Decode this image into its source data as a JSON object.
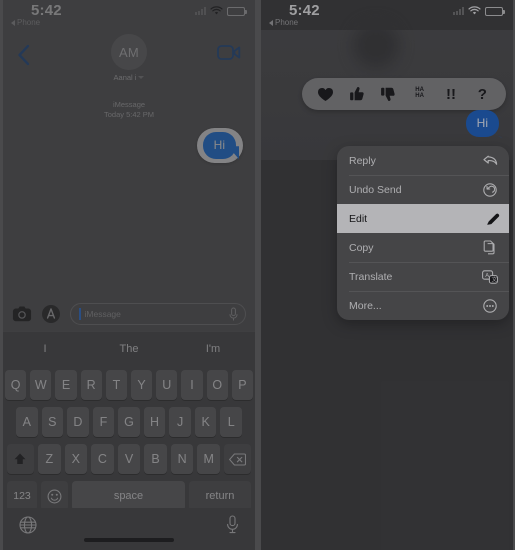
{
  "meta": {
    "app": "Messages",
    "description": "iOS Messages — edit sent message via long-press context menu"
  },
  "colors": {
    "bubble_blue": "#1a7bf2",
    "bubble_blue_dim": "#1b5fc0",
    "menu_bg": "#58585a",
    "selected_row_bg": "#f7f7f9",
    "accent_tint": "#2e7df0"
  },
  "left_panel": {
    "status_bar": {
      "time": "5:42",
      "back_label": "Phone",
      "back_icon": "triangle-left-icon",
      "signal_icon": "cellular-signal-icon",
      "wifi_icon": "wifi-icon",
      "battery_icon": "battery-icon"
    },
    "nav_bar": {
      "back_icon": "chevron-left-icon",
      "facetime_icon": "video-camera-icon",
      "avatar_initials": "AM",
      "contact_name": "Aanal i",
      "disclosure_icon": "chevron-down-icon"
    },
    "thread": {
      "service_label": "iMessage",
      "timestamp": "Today 5:42 PM",
      "messages": [
        {
          "text": "Hi",
          "side": "outgoing",
          "highlighted": true
        }
      ]
    },
    "input_bar": {
      "camera_icon": "camera-icon",
      "apps_icon": "app-store-icon",
      "placeholder": "iMessage",
      "audio_icon": "audio-waveform-icon"
    },
    "predictive_bar": {
      "suggestions": [
        "I",
        "The",
        "I'm"
      ]
    },
    "keyboard": {
      "row1": [
        "Q",
        "W",
        "E",
        "R",
        "T",
        "Y",
        "U",
        "I",
        "O",
        "P"
      ],
      "row2": [
        "A",
        "S",
        "D",
        "F",
        "G",
        "H",
        "J",
        "K",
        "L"
      ],
      "row3": [
        "Z",
        "X",
        "C",
        "V",
        "B",
        "N",
        "M"
      ],
      "shift_icon": "shift-icon",
      "delete_icon": "delete-backward-icon",
      "numbers_label": "123",
      "emoji_icon": "emoji-smiley-icon",
      "space_label": "space",
      "return_label": "return"
    },
    "bottom_bar": {
      "globe_icon": "globe-icon",
      "dictation_icon": "microphone-icon",
      "home_indicator": "home-indicator"
    }
  },
  "right_panel": {
    "status_bar": {
      "time": "5:42",
      "back_label": "Phone",
      "back_icon": "triangle-left-icon",
      "signal_icon": "cellular-signal-icon",
      "wifi_icon": "wifi-icon",
      "battery_icon": "battery-icon"
    },
    "tapbacks": [
      {
        "name": "heart-icon",
        "glyph": "♥",
        "label": "Love"
      },
      {
        "name": "thumbs-up-icon",
        "glyph": "👍",
        "label": "Like"
      },
      {
        "name": "thumbs-down-icon",
        "glyph": "👎",
        "label": "Dislike"
      },
      {
        "name": "haha-icon",
        "glyph": "HA\nHA",
        "label": "HA HA"
      },
      {
        "name": "exclamation-icon",
        "glyph": "!!",
        "label": "Emphasize"
      },
      {
        "name": "question-icon",
        "glyph": "?",
        "label": "Question"
      }
    ],
    "message": {
      "text": "Hi",
      "side": "outgoing"
    },
    "context_menu": [
      {
        "label": "Reply",
        "icon": "reply-arrow-icon",
        "selected": false
      },
      {
        "label": "Undo Send",
        "icon": "undo-circle-icon",
        "selected": false
      },
      {
        "label": "Edit",
        "icon": "pencil-icon",
        "selected": true
      },
      {
        "label": "Copy",
        "icon": "copy-pages-icon",
        "selected": false
      },
      {
        "label": "Translate",
        "icon": "translate-icon",
        "selected": false
      },
      {
        "label": "More...",
        "icon": "ellipsis-circle-icon",
        "selected": false
      }
    ]
  }
}
